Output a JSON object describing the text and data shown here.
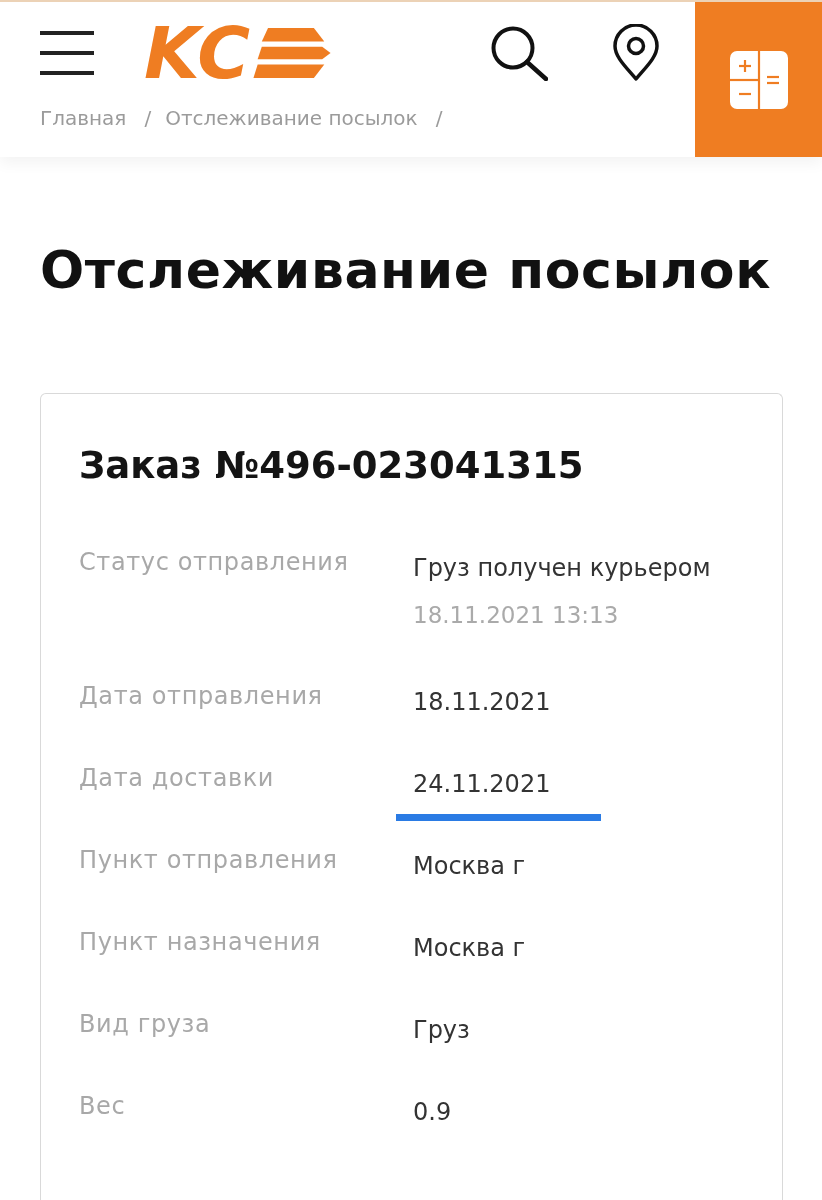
{
  "header": {
    "logo": {
      "text": "KC"
    },
    "breadcrumbs": [
      {
        "label": "Главная",
        "separator": "/"
      },
      {
        "label": "Отслеживание посылок",
        "separator": "/"
      }
    ]
  },
  "page_title": "Отслеживание посылок",
  "order": {
    "title": "Заказ №496-023041315",
    "rows": [
      {
        "label": "Статус отправления",
        "value": "Груз получен курьером",
        "note": "18.11.2021 13:13",
        "underlined": false
      },
      {
        "label": "Дата отправления",
        "value": "18.11.2021",
        "underlined": false
      },
      {
        "label": "Дата доставки",
        "value": "24.11.2021",
        "underlined": true
      },
      {
        "label": "Пункт отправления",
        "value": "Москва г",
        "underlined": false
      },
      {
        "label": "Пункт назначения",
        "value": "Москва г",
        "underlined": false
      },
      {
        "label": "Вид груза",
        "value": "Груз",
        "underlined": false
      },
      {
        "label": "Вес",
        "value": "0.9",
        "underlined": false
      }
    ]
  }
}
